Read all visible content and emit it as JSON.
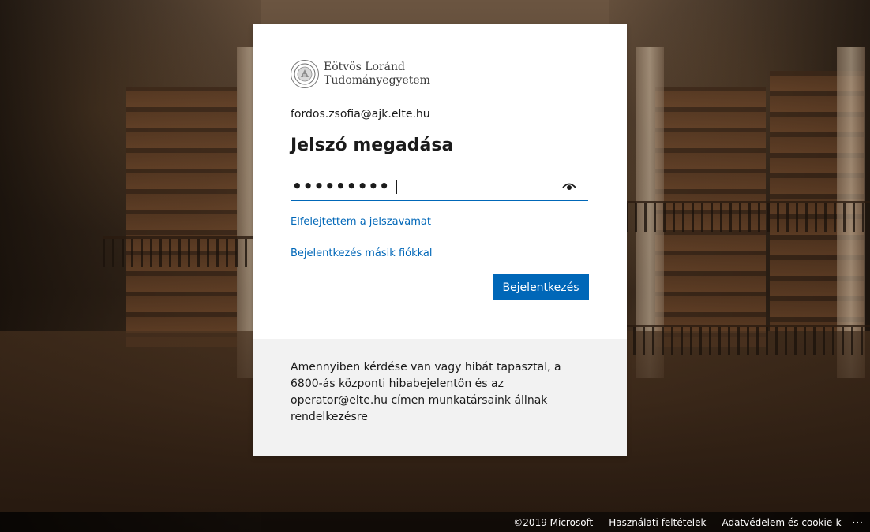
{
  "logo": {
    "line1": "Eötvös Loránd",
    "line2": "Tudományegyetem",
    "icon": "university-seal-icon"
  },
  "account": {
    "email": "fordos.zsofia@ajk.elte.hu"
  },
  "page": {
    "title": "Jelszó megadása"
  },
  "password": {
    "value": "•••••••••",
    "reveal_icon": "eye-icon"
  },
  "links": {
    "forgot": "Elfelejtettem a jelszavamat",
    "other_account": "Bejelentkezés másik fiókkal"
  },
  "buttons": {
    "sign_in": "Bejelentkezés"
  },
  "help": {
    "text": "Amennyiben kérdése van vagy hibát tapasztal, a 6800-ás központi hibabejelentőn és az operator@elte.hu címen munkatársaink állnak rendelkezésre"
  },
  "footer": {
    "copyright": "©2019 Microsoft",
    "terms": "Használati feltételek",
    "privacy": "Adatvédelem és cookie-k",
    "more": "···"
  },
  "colors": {
    "accent": "#0067b8",
    "card_background": "#ffffff",
    "footer_panel": "#f2f2f2"
  }
}
